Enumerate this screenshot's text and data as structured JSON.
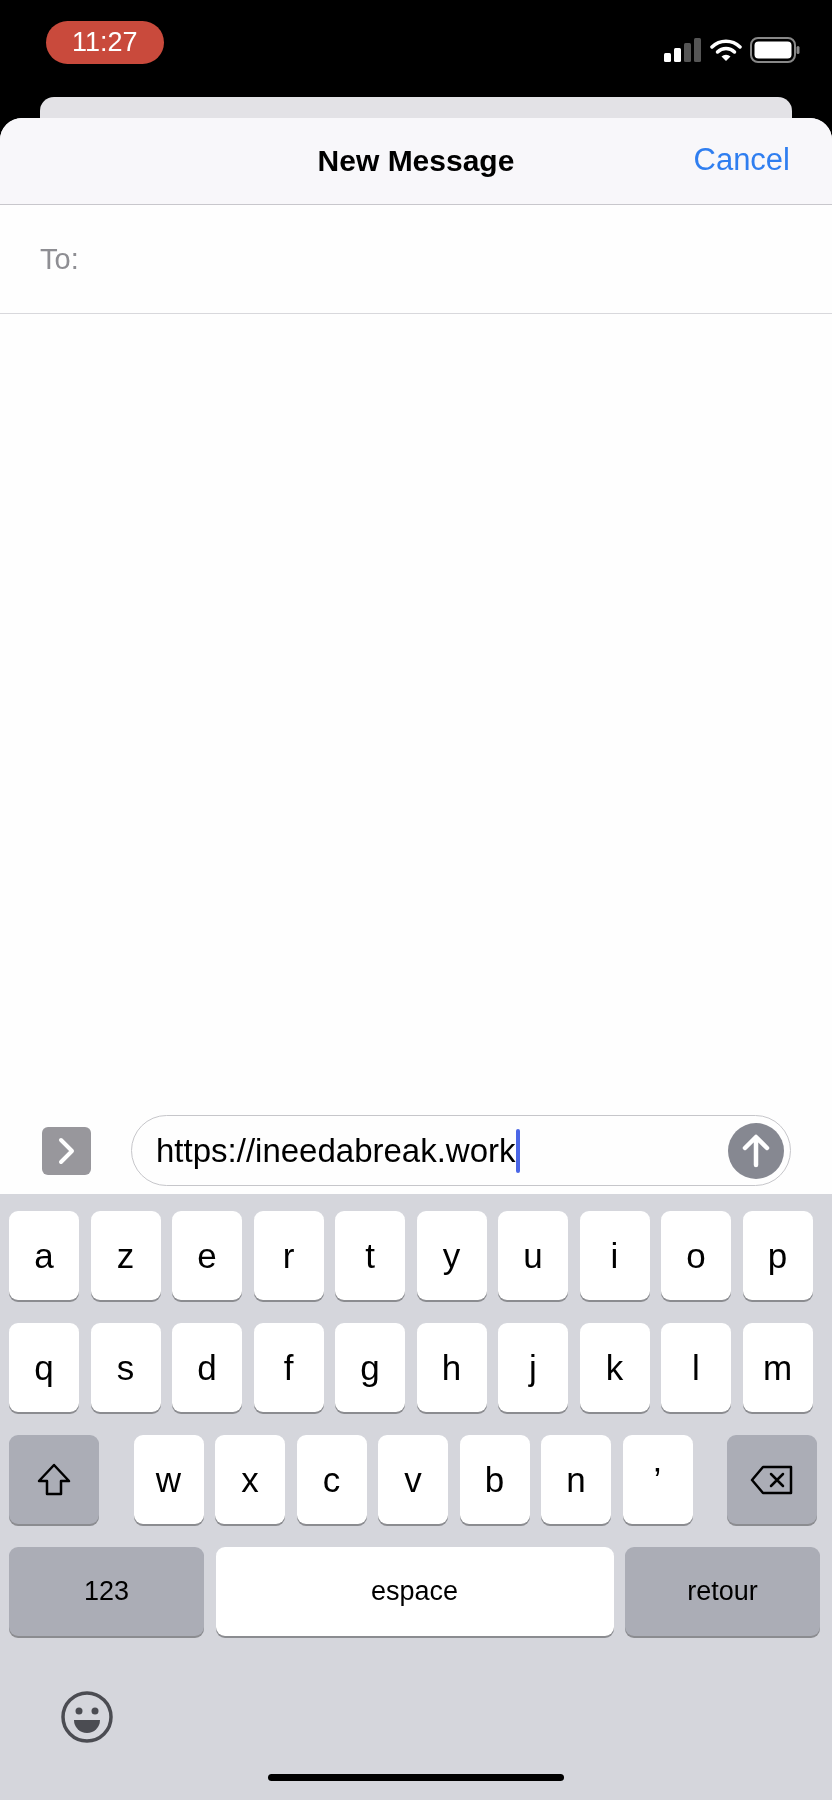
{
  "status_bar": {
    "time": "11:27"
  },
  "header": {
    "title": "New Message",
    "cancel": "Cancel"
  },
  "to_field": {
    "label": "To:"
  },
  "compose": {
    "value": "https://ineedabreak.work"
  },
  "keyboard": {
    "rows": [
      {
        "keys": [
          {
            "kind": "letter",
            "label": "a"
          },
          {
            "kind": "letter",
            "label": "z"
          },
          {
            "kind": "letter",
            "label": "e"
          },
          {
            "kind": "letter",
            "label": "r"
          },
          {
            "kind": "letter",
            "label": "t"
          },
          {
            "kind": "letter",
            "label": "y"
          },
          {
            "kind": "letter",
            "label": "u"
          },
          {
            "kind": "letter",
            "label": "i"
          },
          {
            "kind": "letter",
            "label": "o"
          },
          {
            "kind": "letter",
            "label": "p"
          }
        ]
      },
      {
        "keys": [
          {
            "kind": "letter",
            "label": "q"
          },
          {
            "kind": "letter",
            "label": "s"
          },
          {
            "kind": "letter",
            "label": "d"
          },
          {
            "kind": "letter",
            "label": "f"
          },
          {
            "kind": "letter",
            "label": "g"
          },
          {
            "kind": "letter",
            "label": "h"
          },
          {
            "kind": "letter",
            "label": "j"
          },
          {
            "kind": "letter",
            "label": "k"
          },
          {
            "kind": "letter",
            "label": "l"
          },
          {
            "kind": "letter",
            "label": "m"
          }
        ]
      },
      {
        "keys": [
          {
            "kind": "shift"
          },
          {
            "kind": "letter",
            "label": "w"
          },
          {
            "kind": "letter",
            "label": "x"
          },
          {
            "kind": "letter",
            "label": "c"
          },
          {
            "kind": "letter",
            "label": "v"
          },
          {
            "kind": "letter",
            "label": "b"
          },
          {
            "kind": "letter",
            "label": "n"
          },
          {
            "kind": "letter",
            "label": "’"
          },
          {
            "kind": "delete"
          }
        ]
      },
      {
        "keys": [
          {
            "kind": "numbers",
            "label": "123"
          },
          {
            "kind": "space",
            "label": "espace"
          },
          {
            "kind": "return",
            "label": "retour"
          }
        ]
      }
    ]
  }
}
